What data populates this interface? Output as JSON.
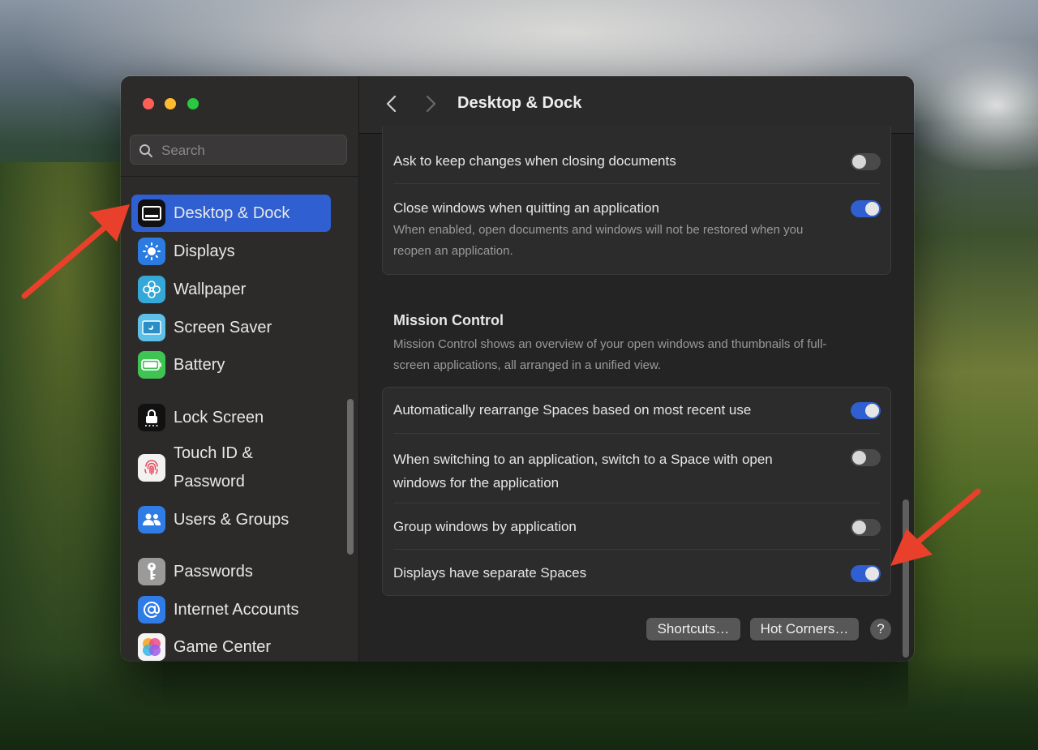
{
  "window": {
    "title": "Desktop & Dock"
  },
  "search": {
    "placeholder": "Search"
  },
  "sidebar": {
    "items": [
      {
        "label": "Desktop & Dock",
        "active": true,
        "icon": "dock-icon"
      },
      {
        "label": "Displays",
        "icon": "sun-icon"
      },
      {
        "label": "Wallpaper",
        "icon": "flower-icon"
      },
      {
        "label": "Screen Saver",
        "icon": "screensaver-icon"
      },
      {
        "label": "Battery",
        "icon": "battery-icon"
      },
      {
        "label": "Lock Screen",
        "icon": "lock-icon"
      },
      {
        "label": "Touch ID &",
        "label2": "Password",
        "icon": "fingerprint-icon"
      },
      {
        "label": "Users & Groups",
        "icon": "users-icon"
      },
      {
        "label": "Passwords",
        "icon": "key-icon"
      },
      {
        "label": "Internet Accounts",
        "icon": "at-icon"
      },
      {
        "label": "Game Center",
        "icon": "game-center-icon"
      }
    ]
  },
  "windows_group": {
    "rows": [
      {
        "label": "Ask to keep changes when closing documents",
        "enabled": false
      },
      {
        "label": "Close windows when quitting an application",
        "enabled": true,
        "sub1": "When enabled, open documents and windows will not be restored when you",
        "sub2": "reopen an application."
      }
    ]
  },
  "mission_control": {
    "title": "Mission Control",
    "desc1": "Mission Control shows an overview of your open windows and thumbnails of full-",
    "desc2": "screen applications, all arranged in a unified view.",
    "rows": [
      {
        "label": "Automatically rearrange Spaces based on most recent use",
        "enabled": true
      },
      {
        "label": "When switching to an application, switch to a Space with open",
        "label2": "windows for the application",
        "enabled": false
      },
      {
        "label": "Group windows by application",
        "enabled": false
      },
      {
        "label": "Displays have separate Spaces",
        "enabled": true
      }
    ]
  },
  "buttons": {
    "shortcuts": "Shortcuts…",
    "hot_corners": "Hot Corners…",
    "help": "?"
  },
  "colors": {
    "accent": "#2f5fd0",
    "annotation_arrow": "#e8402a"
  }
}
